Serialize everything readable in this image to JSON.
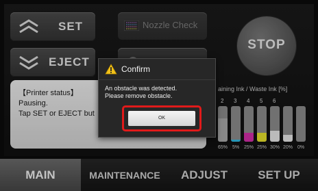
{
  "buttons": {
    "set_label": "SET",
    "eject_label": "EJECT",
    "nozzle_label": "Nozzle Check",
    "stop_label": "STOP"
  },
  "status": {
    "title": "【Printer status】",
    "line1": "Pausing.",
    "line2": "Tap SET or EJECT but"
  },
  "ink": {
    "header": "aining Ink / Waste Ink [%]",
    "tanks": [
      {
        "number": "2",
        "level": 0.65,
        "percent": "65%",
        "color": "#a6a6a6"
      },
      {
        "number": "3",
        "level": 0.05,
        "percent": "5%",
        "color": "#2fb8e0"
      },
      {
        "number": "4",
        "level": 0.25,
        "percent": "25%",
        "color": "#d12ea6"
      },
      {
        "number": "5",
        "level": 0.25,
        "percent": "25%",
        "color": "#e4de2c"
      },
      {
        "number": "6",
        "level": 0.3,
        "percent": "30%",
        "color": "#e4e4e4"
      },
      {
        "number": "",
        "level": 0.2,
        "percent": "20%",
        "color": "#e4e4e4"
      },
      {
        "number": "",
        "level": 0.0,
        "percent": "0%",
        "color": "#e4e4e4"
      }
    ]
  },
  "nav": {
    "tabs": [
      {
        "label": "MAIN",
        "active": true
      },
      {
        "label": "MAINTENANCE"
      },
      {
        "label": "ADJUST"
      },
      {
        "label": "SET UP"
      }
    ]
  },
  "dialog": {
    "title": "Confirm",
    "message_line1": "An obstacle was detected.",
    "message_line2": "Please remove obstacle.",
    "ok_label": "OK"
  },
  "colors": {
    "highlight": "#e11a1a",
    "warning": "#f2c21b"
  }
}
